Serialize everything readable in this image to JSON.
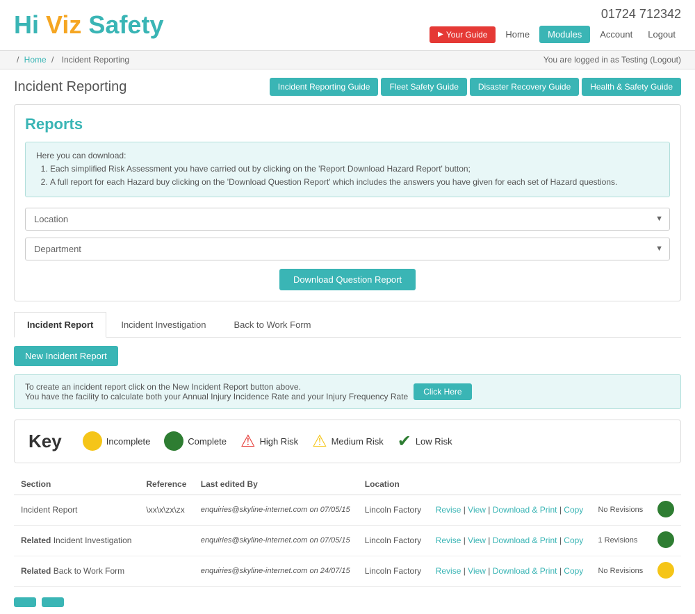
{
  "header": {
    "logo_hi": "Hi",
    "logo_viz": "Viz",
    "logo_safety": "Safety",
    "phone": "01724 712342",
    "your_guide_label": "Your Guide",
    "home_label": "Home",
    "modules_label": "Modules",
    "account_label": "Account",
    "logout_label": "Logout"
  },
  "breadcrumb": {
    "home": "Home",
    "current": "Incident Reporting",
    "logged_in": "You are logged in as Testing (Logout)"
  },
  "page_title": "Incident Reporting",
  "guide_buttons": [
    "Incident Reporting Guide",
    "Fleet Safety Guide",
    "Disaster Recovery Guide",
    "Health & Safety Guide"
  ],
  "reports": {
    "title": "Reports",
    "info_line1": "Here you can download:",
    "info_item1": "Each simplified Risk Assessment you have carried out by clicking on the 'Report Download Hazard Report' button;",
    "info_item2": "A full report for each Hazard buy clicking on the 'Download Question Report' which includes the answers you have given for each set of Hazard questions.",
    "location_placeholder": "Location",
    "department_placeholder": "Department",
    "download_btn": "Download Question Report"
  },
  "tabs": [
    {
      "id": "incident-report",
      "label": "Incident Report",
      "active": true
    },
    {
      "id": "incident-investigation",
      "label": "Incident Investigation",
      "active": false
    },
    {
      "id": "back-to-work",
      "label": "Back to Work Form",
      "active": false
    }
  ],
  "new_incident_btn": "New Incident Report",
  "info_banner": {
    "line1": "To create an incident report click on the New Incident Report button above.",
    "line2": "You have the facility to calculate both your Annual Injury Incidence Rate and your Injury Frequency Rate",
    "click_here": "Click Here"
  },
  "key": {
    "title": "Key",
    "items": [
      {
        "type": "circle-yellow",
        "label": "Incomplete"
      },
      {
        "type": "circle-green",
        "label": "Complete"
      },
      {
        "type": "high-risk",
        "label": "High Risk"
      },
      {
        "type": "medium-risk",
        "label": "Medium Risk"
      },
      {
        "type": "low-risk",
        "label": "Low Risk"
      }
    ]
  },
  "table": {
    "headers": [
      "Section",
      "Reference",
      "Last edited By",
      "Location",
      "",
      "",
      ""
    ],
    "rows": [
      {
        "section": "Incident Report",
        "reference": "\\xx\\x\\zx\\zx",
        "last_edited": "enquiries@skyline-internet.com on 07/05/15",
        "location": "Lincoln Factory",
        "actions": "Revise | View | Download & Print | Copy",
        "revisions": "No Revisions",
        "status": "green"
      },
      {
        "section_related": "Related",
        "section": "Incident Investigation",
        "reference": "",
        "last_edited": "enquiries@skyline-internet.com on 07/05/15",
        "location": "Lincoln Factory",
        "actions": "Revise | View | Download & Print | Copy",
        "revisions": "1 Revisions",
        "status": "green"
      },
      {
        "section_related": "Related",
        "section": "Back to Work Form",
        "reference": "",
        "last_edited": "enquiries@skyline-internet.com on 24/07/15",
        "location": "Lincoln Factory",
        "actions": "Revise | View | Download & Print | Copy",
        "revisions": "No Revisions",
        "status": "yellow"
      }
    ]
  },
  "bottom_buttons": [
    "",
    ""
  ]
}
